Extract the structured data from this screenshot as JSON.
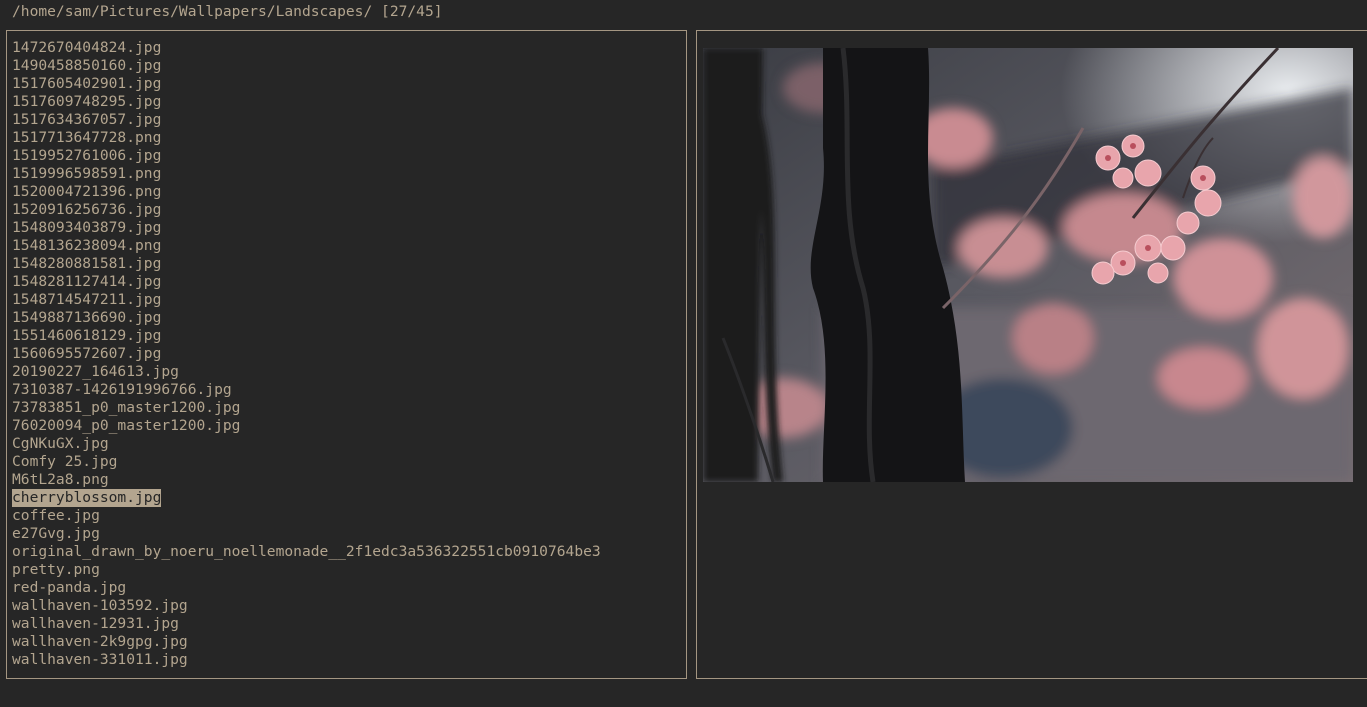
{
  "header": {
    "path": "/home/sam/Pictures/Wallpapers/Landscapes/",
    "position": "[27/45]"
  },
  "files": [
    "1472670404824.jpg",
    "1490458850160.jpg",
    "1517605402901.jpg",
    "1517609748295.jpg",
    "1517634367057.jpg",
    "1517713647728.png",
    "1519952761006.jpg",
    "1519996598591.png",
    "1520004721396.png",
    "1520916256736.jpg",
    "1548093403879.jpg",
    "1548136238094.png",
    "1548280881581.jpg",
    "1548281127414.jpg",
    "1548714547211.jpg",
    "1549887136690.jpg",
    "1551460618129.jpg",
    "1560695572607.jpg",
    "20190227_164613.jpg",
    "7310387-1426191996766.jpg",
    "73783851_p0_master1200.jpg",
    "76020094_p0_master1200.jpg",
    "CgNKuGX.jpg",
    "Comfy 25.jpg",
    "M6tL2a8.png",
    "cherryblossom.jpg",
    "coffee.jpg",
    "e27Gvg.jpg",
    "original_drawn_by_noeru_noellemonade__2f1edc3a536322551cb0910764be3",
    "pretty.png",
    "red-panda.jpg",
    "wallhaven-103592.jpg",
    "wallhaven-12931.jpg",
    "wallhaven-2k9gpg.jpg",
    "wallhaven-331011.jpg"
  ],
  "selected_file": "cherryblossom.jpg",
  "colors": {
    "background": "#262626",
    "text": "#b3a58f",
    "border": "#a49682",
    "selection_bg": "#b3a58f"
  }
}
